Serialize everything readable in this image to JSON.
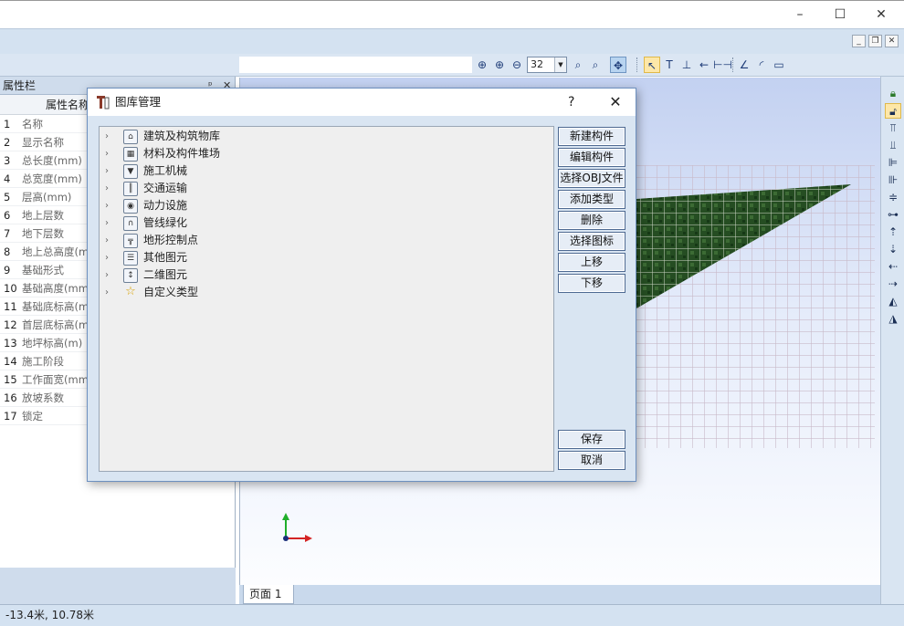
{
  "window": {
    "minimize": "–",
    "maximize": "☐",
    "close": "✕"
  },
  "mdi": {
    "minimize": "_",
    "restore": "❐",
    "close": "✕"
  },
  "toolbar": {
    "zoom_value": "32",
    "icons": [
      "zoom-in-icon",
      "zoom-area-icon",
      "zoom-out-icon",
      "zoom-window-icon",
      "zoom-fit-icon",
      "pan-icon",
      "select-icon",
      "text-icon",
      "dimension-icon",
      "arrow-icon",
      "measure-icon",
      "polyline-icon",
      "arc-icon",
      "rectangle-icon"
    ]
  },
  "left_panel": {
    "title": "属性栏",
    "pin": "ᵖ",
    "close": "✕",
    "column_header": "属性名称",
    "rows": [
      {
        "num": "1",
        "name": "名称"
      },
      {
        "num": "2",
        "name": "显示名称"
      },
      {
        "num": "3",
        "name": "总长度(mm)"
      },
      {
        "num": "4",
        "name": "总宽度(mm)"
      },
      {
        "num": "5",
        "name": "层高(mm)"
      },
      {
        "num": "6",
        "name": "地上层数"
      },
      {
        "num": "7",
        "name": "地下层数"
      },
      {
        "num": "8",
        "name": "地上总高度(m"
      },
      {
        "num": "9",
        "name": "基础形式"
      },
      {
        "num": "10",
        "name": "基础高度(mm"
      },
      {
        "num": "11",
        "name": "基础底标高(m"
      },
      {
        "num": "12",
        "name": "首层底标高(m"
      },
      {
        "num": "13",
        "name": "地坪标高(m)"
      },
      {
        "num": "14",
        "name": "施工阶段"
      },
      {
        "num": "15",
        "name": "工作面宽(mm"
      },
      {
        "num": "16",
        "name": "放坡系数"
      },
      {
        "num": "17",
        "name": "锁定"
      }
    ]
  },
  "tabs": {
    "page1": "页面 1"
  },
  "status": {
    "coords": "-13.4米, 10.78米"
  },
  "dialog": {
    "title": "图库管理",
    "help": "?",
    "close": "✕",
    "tree": [
      {
        "label": "建筑及构筑物库",
        "icon": "building-icon",
        "glyph": "⌂"
      },
      {
        "label": "材料及构件堆场",
        "icon": "material-yard-icon",
        "glyph": "▦"
      },
      {
        "label": "施工机械",
        "icon": "machine-icon",
        "glyph": "▼"
      },
      {
        "label": "交通运输",
        "icon": "transport-icon",
        "glyph": "║"
      },
      {
        "label": "动力设施",
        "icon": "power-icon",
        "glyph": "◉"
      },
      {
        "label": "管线绿化",
        "icon": "pipeline-icon",
        "glyph": "∩"
      },
      {
        "label": "地形控制点",
        "icon": "terrain-icon",
        "glyph": "╦"
      },
      {
        "label": "其他图元",
        "icon": "other-icon",
        "glyph": "☰"
      },
      {
        "label": "二维图元",
        "icon": "2d-element-icon",
        "glyph": "↕"
      },
      {
        "label": "自定义类型",
        "icon": "star-icon",
        "glyph": "☆"
      }
    ],
    "buttons": {
      "new": "新建构件",
      "edit": "编辑构件",
      "select_obj": "选择OBJ文件",
      "add_type": "添加类型",
      "delete": "删除",
      "select_icon": "选择图标",
      "move_up": "上移",
      "move_down": "下移",
      "save": "保存",
      "cancel": "取消"
    }
  },
  "colors": {
    "accent": "#6d90bf",
    "panel": "#d9e5f2",
    "terrain": "#1f4a1f"
  }
}
